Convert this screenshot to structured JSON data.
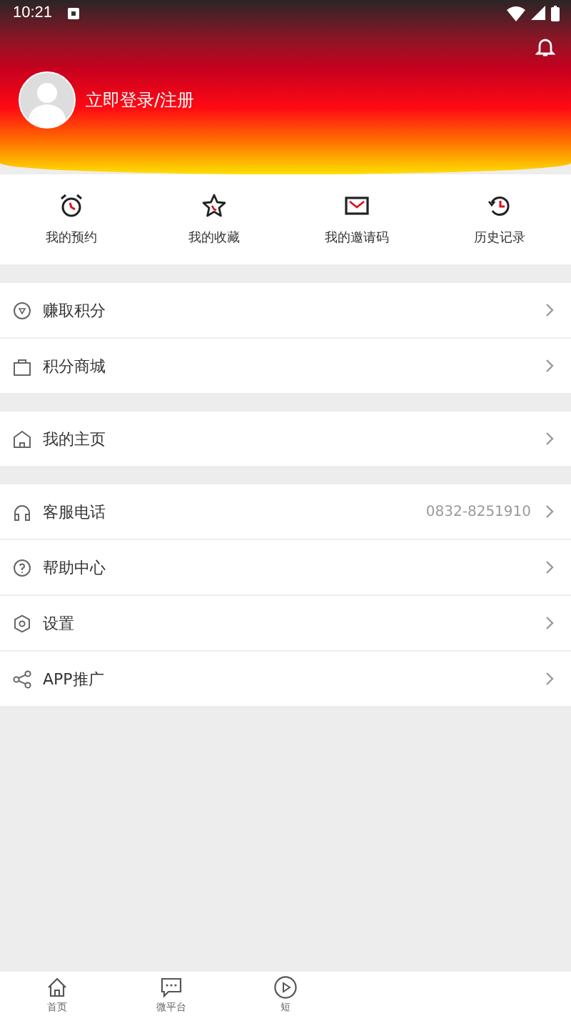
{
  "status_bar": {
    "time": "10:21"
  },
  "profile": {
    "login_text": "立即登录/注册"
  },
  "shortcuts": [
    {
      "kind": "alarm",
      "label": "我的预约"
    },
    {
      "kind": "star",
      "label": "我的收藏"
    },
    {
      "kind": "mail",
      "label": "我的邀请码"
    },
    {
      "kind": "history",
      "label": "历史记录"
    }
  ],
  "menu_groups": [
    [
      {
        "kind": "points",
        "label": "赚取积分"
      },
      {
        "kind": "bag",
        "label": "积分商城"
      }
    ],
    [
      {
        "kind": "home",
        "label": "我的主页"
      }
    ],
    [
      {
        "kind": "headset",
        "label": "客服电话",
        "value": "0832-8251910"
      },
      {
        "kind": "help",
        "label": "帮助中心"
      },
      {
        "kind": "settings",
        "label": "设置"
      },
      {
        "kind": "share",
        "label": "APP推广"
      }
    ]
  ],
  "bottom_nav": [
    {
      "kind": "home",
      "label": "首页"
    },
    {
      "kind": "chat",
      "label": "微平台"
    },
    {
      "kind": "play",
      "label": "短"
    }
  ]
}
